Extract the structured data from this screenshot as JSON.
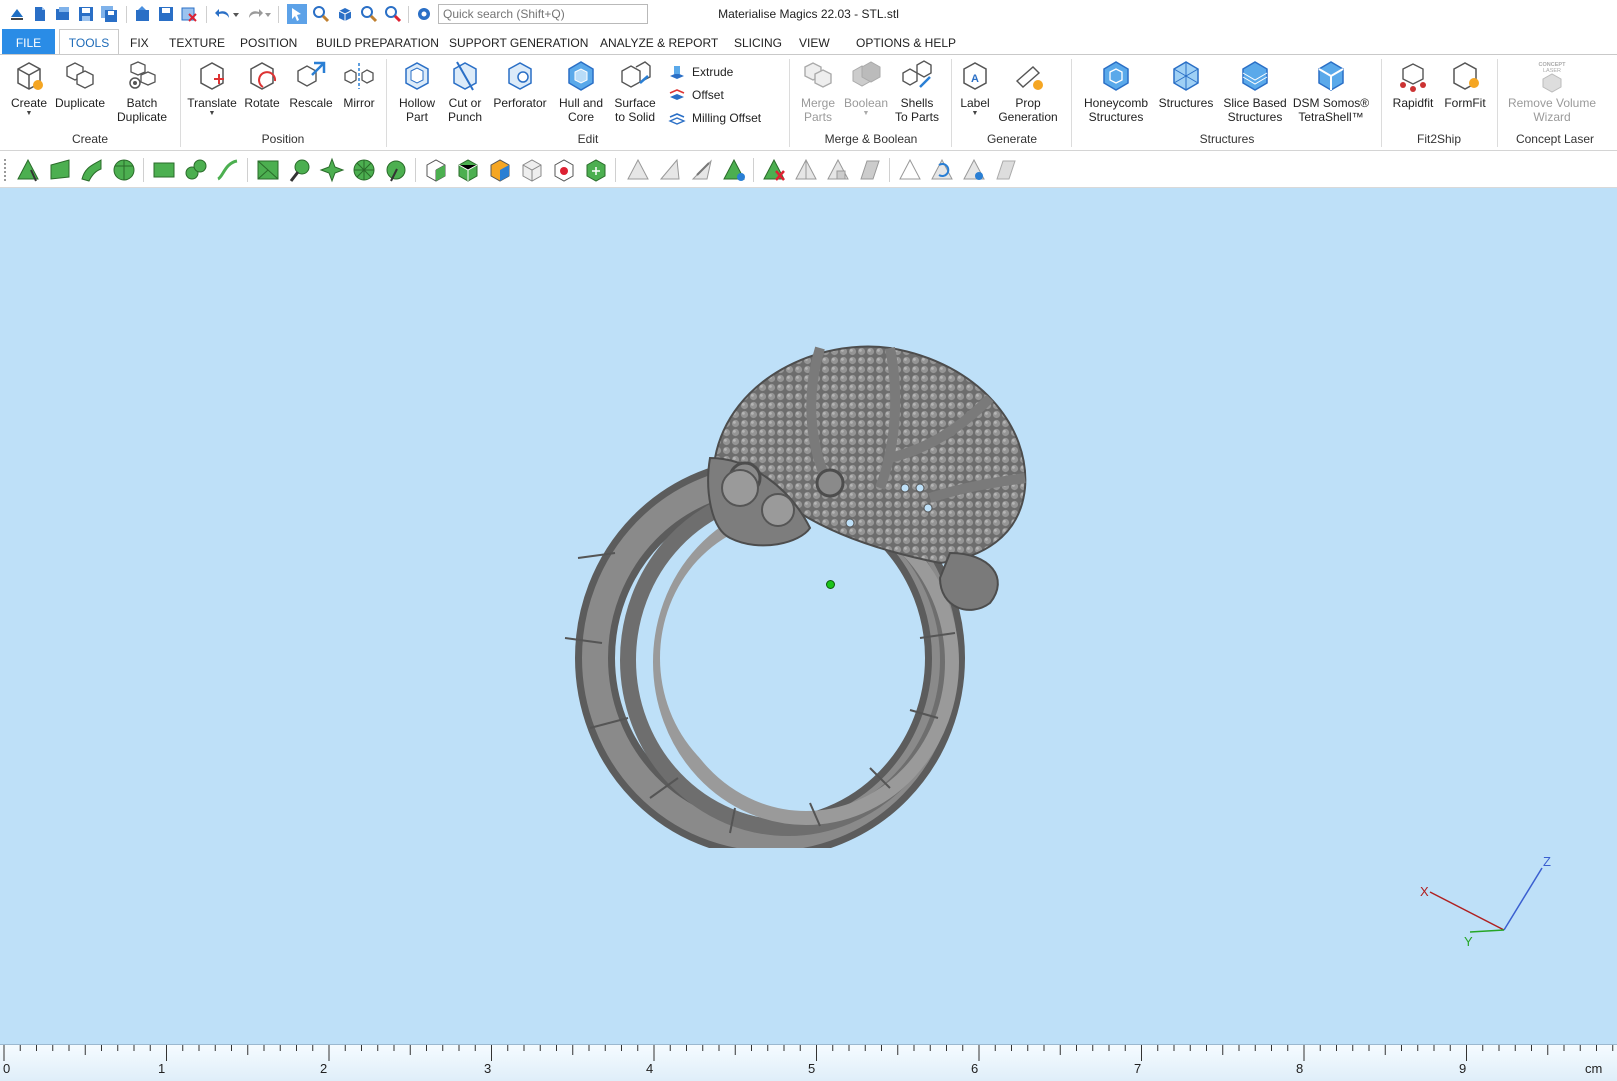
{
  "window": {
    "title": "Materialise Magics 22.03 - STL.stl"
  },
  "quick_search": {
    "placeholder": "Quick search (Shift+Q)"
  },
  "menu": {
    "tabs": [
      "FILE",
      "TOOLS",
      "FIX",
      "TEXTURE",
      "POSITION",
      "BUILD PREPARATION",
      "SUPPORT GENERATION",
      "ANALYZE & REPORT",
      "SLICING",
      "VIEW",
      "OPTIONS & HELP"
    ],
    "active": "TOOLS"
  },
  "ribbon": {
    "create": {
      "group": "Create",
      "create": "Create",
      "duplicate": "Duplicate",
      "batch_duplicate": "Batch\nDuplicate"
    },
    "position": {
      "group": "Position",
      "translate": "Translate",
      "rotate": "Rotate",
      "rescale": "Rescale",
      "mirror": "Mirror"
    },
    "edit": {
      "group": "Edit",
      "hollow_part": "Hollow\nPart",
      "cut_or_punch": "Cut or\nPunch",
      "perforator": "Perforator",
      "hull_and_core": "Hull and\nCore",
      "surface_to_solid": "Surface\nto Solid",
      "extrude": "Extrude",
      "offset": "Offset",
      "milling_offset": "Milling Offset"
    },
    "merge": {
      "group": "Merge & Boolean",
      "merge_parts": "Merge\nParts",
      "boolean": "Boolean",
      "shells_to_parts": "Shells\nTo Parts"
    },
    "generate": {
      "group": "Generate",
      "label": "Label",
      "prop_generation": "Prop\nGeneration"
    },
    "structures": {
      "group": "Structures",
      "honeycomb": "Honeycomb\nStructures",
      "structures": "Structures",
      "slice_based": "Slice Based\nStructures",
      "dsm_somos": "DSM Somos®\nTetraShell™"
    },
    "fit2ship": {
      "group": "Fit2Ship",
      "rapidfit": "Rapidfit",
      "formfit": "FormFit"
    },
    "concept_laser": {
      "group": "Concept Laser",
      "remove_volume_wizard": "Remove Volume\nWizard",
      "logo_text": "CONCEPT\nLASER"
    }
  },
  "viewport": {
    "background": "#bee0f8",
    "axes": {
      "x": "X",
      "y": "Y",
      "z": "Z"
    }
  },
  "ruler": {
    "unit": "cm",
    "labels": [
      "0",
      "1",
      "2",
      "3",
      "4",
      "5",
      "6",
      "7",
      "8",
      "9"
    ]
  },
  "colors": {
    "accent": "#2a8ce6",
    "tab_active_text": "#1e6bb8",
    "model": "#7a7a7a"
  }
}
